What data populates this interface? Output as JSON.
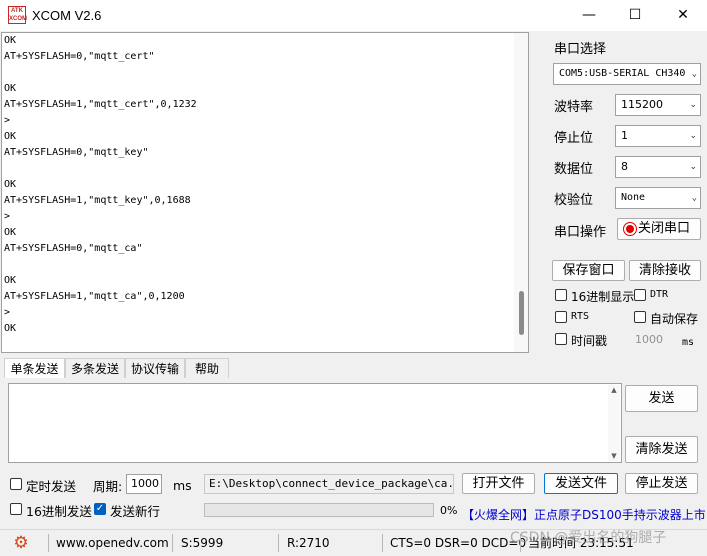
{
  "window": {
    "title": "XCOM V2.6",
    "logo_text": "ATK XCOM",
    "minimize_glyph": "—",
    "maximize_glyph": "☐",
    "close_glyph": "✕"
  },
  "receive": {
    "lines": [
      "OK",
      "AT+SYSFLASH=0,\"mqtt_cert\"",
      "",
      "OK",
      "AT+SYSFLASH=1,\"mqtt_cert\",0,1232",
      ">",
      "OK",
      "AT+SYSFLASH=0,\"mqtt_key\"",
      "",
      "OK",
      "AT+SYSFLASH=1,\"mqtt_key\",0,1688",
      ">",
      "OK",
      "AT+SYSFLASH=0,\"mqtt_ca\"",
      "",
      "OK",
      "AT+SYSFLASH=1,\"mqtt_ca\",0,1200",
      ">",
      "OK"
    ]
  },
  "settings": {
    "port_select_label": "串口选择",
    "port_value": "COM5:USB-SERIAL CH340",
    "baud_label": "波特率",
    "baud_value": "115200",
    "stopbits_label": "停止位",
    "stopbits_value": "1",
    "databits_label": "数据位",
    "databits_value": "8",
    "parity_label": "校验位",
    "parity_value": "None",
    "port_op_label": "串口操作",
    "close_port_button": "关闭串口",
    "save_window_button": "保存窗口",
    "clear_receive_button": "清除接收",
    "hex_display_label": "16进制显示",
    "dtr_label": "DTR",
    "rts_label": "RTS",
    "auto_save_label": "自动保存",
    "timestamp_label": "时间戳",
    "timestamp_value": "1000",
    "timestamp_unit": "ms"
  },
  "tabs": [
    "单条发送",
    "多条发送",
    "协议传输",
    "帮助"
  ],
  "send": {
    "send_button": "发送",
    "clear_send_button": "清除发送",
    "timed_send_label": "定时发送",
    "period_label": "周期:",
    "period_value": "1000",
    "period_unit": "ms",
    "file_path": "E:\\Desktop\\connect_device_package\\ca.bin",
    "open_file_button": "打开文件",
    "send_file_button": "发送文件",
    "stop_send_button": "停止发送",
    "hex_send_label": "16进制发送",
    "newline_label": "发送新行",
    "progress_text": "0%",
    "progress_fraction": 0
  },
  "ad": {
    "text": "【火爆全网】正点原子DS100手持示波器上市"
  },
  "status": {
    "website": "www.openedv.com",
    "sent": "S:5999",
    "received": "R:2710",
    "signals": "CTS=0 DSR=0 DCD=0",
    "time": "当前时间 23:15:51"
  },
  "watermark": "CSDN @爱出名的狗腿子",
  "colors": {
    "close_port_indicator": "#e00000",
    "progress_fill": "#06b025",
    "ad_text": "#0000cc",
    "gear_icon": "#d84315"
  }
}
